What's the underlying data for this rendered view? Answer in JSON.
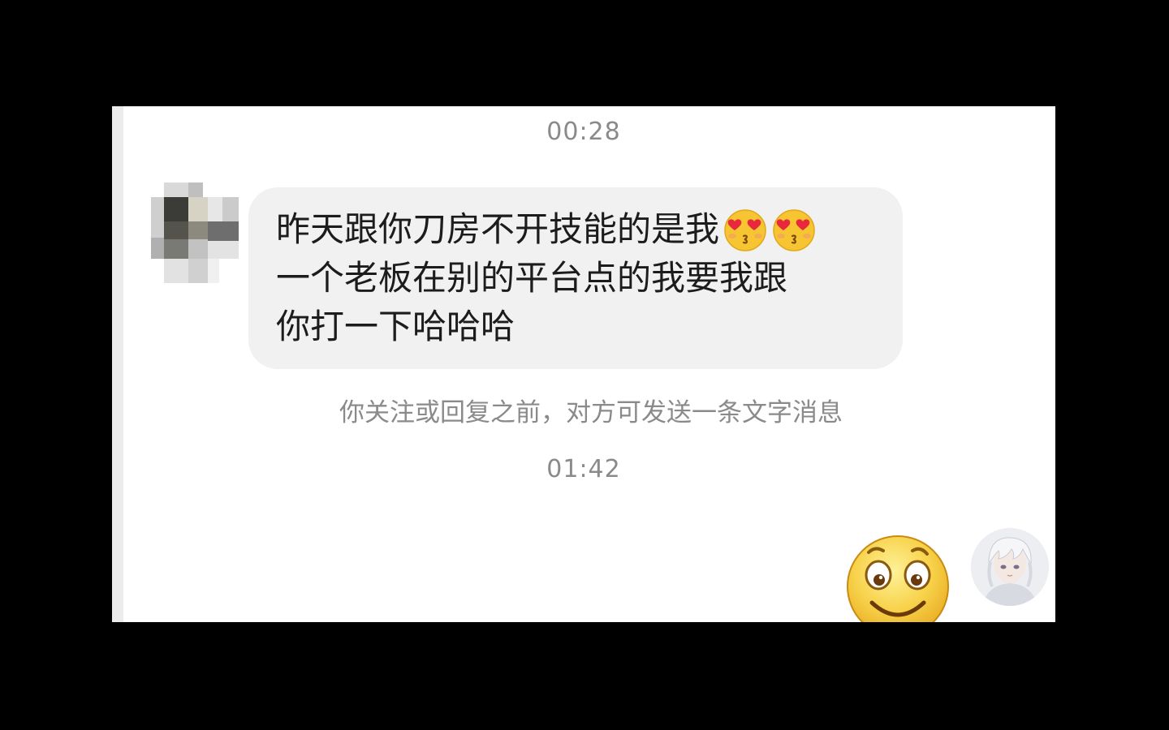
{
  "chat": {
    "timestamp_1": "00:28",
    "timestamp_2": "01:42",
    "message": {
      "line_1": "昨天跟你刀房不开技能的是我",
      "line_2": "一个老板在别的平台点的我要我跟",
      "line_3": "你打一下哈哈哈",
      "inline_emojis": [
        "heart-eyes-kiss-emoji",
        "heart-eyes-kiss-emoji"
      ]
    },
    "notice": "你关注或回复之前，对方可发送一条文字消息",
    "sent_sticker": "smiling-face-sticker"
  },
  "colors": {
    "page_background": "#000000",
    "chat_background": "#ffffff",
    "bubble_background": "#f1f1f1",
    "text_primary": "#1c1c1c",
    "text_secondary": "#8a8a8a",
    "emoji_yellow": "#f7c531"
  }
}
